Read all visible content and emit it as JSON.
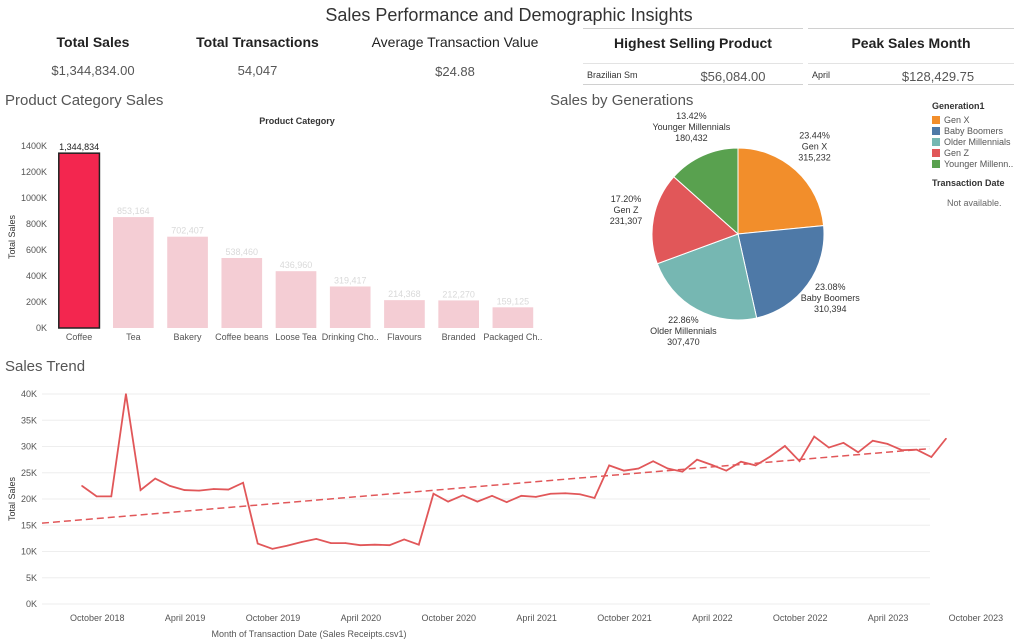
{
  "title": "Sales Performance and Demographic Insights",
  "kpis": {
    "total_sales": {
      "label": "Total Sales",
      "value": "$1,344,834.00"
    },
    "total_transactions": {
      "label": "Total Transactions",
      "value": "54,047"
    },
    "avg_transaction": {
      "label": "Average Transaction Value",
      "value": "$24.88"
    },
    "highest_product": {
      "label": "Highest Selling Product",
      "name": "Brazilian Sm",
      "value": "$56,084.00"
    },
    "peak_month": {
      "label": "Peak Sales Month",
      "name": "April",
      "value": "$128,429.75"
    }
  },
  "category_section": {
    "title": "Product Category Sales"
  },
  "generation_section": {
    "title": "Sales by Generations"
  },
  "trend_section": {
    "title": "Sales Trend"
  },
  "legend": {
    "title": "Generation1",
    "items": [
      {
        "label": "Gen X",
        "color": "#f28e2b"
      },
      {
        "label": "Baby Boomers",
        "color": "#4e79a7"
      },
      {
        "label": "Older Millennials",
        "color": "#76b7b2"
      },
      {
        "label": "Gen Z",
        "color": "#e15759"
      },
      {
        "label": "Younger Millenn..",
        "color": "#59a14f"
      }
    ],
    "filter_title": "Transaction Date",
    "filter_value": "Not available."
  },
  "chart_data": [
    {
      "type": "bar",
      "title": "Product Category",
      "ylabel": "Total Sales",
      "ylim": [
        0,
        1400000
      ],
      "yticks": [
        "0K",
        "200K",
        "400K",
        "600K",
        "800K",
        "1000K",
        "1200K",
        "1400K"
      ],
      "categories": [
        "Coffee",
        "Tea",
        "Bakery",
        "Coffee beans",
        "Loose Tea",
        "Drinking Cho..",
        "Flavours",
        "Branded",
        "Packaged Ch.."
      ],
      "values": [
        1344834,
        853164,
        702407,
        538460,
        436960,
        319417,
        214368,
        212270,
        159125
      ],
      "labels": [
        "1,344,834",
        "853,164",
        "702,407",
        "538,460",
        "436,960",
        "319,417",
        "214,368",
        "212,270",
        "159,125"
      ],
      "highlight_color": "#f3264f",
      "muted_color": "#f4cdd4"
    },
    {
      "type": "pie",
      "slices": [
        {
          "name": "Gen X",
          "pct": "23.44%",
          "value": 315232,
          "value_label": "315,232",
          "color": "#f28e2b"
        },
        {
          "name": "Baby Boomers",
          "pct": "23.08%",
          "value": 310394,
          "value_label": "310,394",
          "color": "#4e79a7"
        },
        {
          "name": "Older Millennials",
          "pct": "22.86%",
          "value": 307470,
          "value_label": "307,470",
          "color": "#76b7b2"
        },
        {
          "name": "Gen Z",
          "pct": "17.20%",
          "value": 231307,
          "value_label": "231,307",
          "color": "#e15759"
        },
        {
          "name": "Younger Millennials",
          "pct": "13.42%",
          "value": 180432,
          "value_label": "180,432",
          "color": "#59a14f"
        }
      ]
    },
    {
      "type": "line",
      "xlabel": "Month of Transaction Date (Sales Receipts.csv1)",
      "ylabel": "Total Sales",
      "ylim": [
        0,
        40000
      ],
      "yticks": [
        "0K",
        "5K",
        "10K",
        "15K",
        "20K",
        "25K",
        "30K",
        "35K",
        "40K"
      ],
      "x_start": "2018-08",
      "xticks": [
        {
          "label": "October 2018",
          "month": "2018-10"
        },
        {
          "label": "April 2019",
          "month": "2019-04"
        },
        {
          "label": "October 2019",
          "month": "2019-10"
        },
        {
          "label": "April 2020",
          "month": "2020-04"
        },
        {
          "label": "October 2020",
          "month": "2020-10"
        },
        {
          "label": "April 2021",
          "month": "2021-04"
        },
        {
          "label": "October 2021",
          "month": "2021-10"
        },
        {
          "label": "April 2022",
          "month": "2022-04"
        },
        {
          "label": "October 2022",
          "month": "2022-10"
        },
        {
          "label": "April 2023",
          "month": "2023-04"
        },
        {
          "label": "October 2023",
          "month": "2023-10"
        }
      ],
      "values": [
        22500,
        20500,
        20500,
        40000,
        21700,
        23900,
        22500,
        21700,
        21600,
        21900,
        21800,
        23100,
        11500,
        10500,
        11100,
        11800,
        12400,
        11600,
        11600,
        11200,
        11300,
        11200,
        12300,
        11300,
        21000,
        19500,
        20700,
        19500,
        20600,
        19400,
        20600,
        20400,
        21000,
        21100,
        20900,
        20200,
        26400,
        25400,
        25800,
        27200,
        25800,
        25200,
        27500,
        26500,
        25400,
        27100,
        26400,
        28100,
        30100,
        27200,
        31900,
        29800,
        30700,
        28900,
        31100,
        30500,
        29300,
        29400,
        28000,
        31500
      ],
      "line_color": "#e15759",
      "trend": {
        "start": 15400,
        "end": 29600
      }
    }
  ]
}
